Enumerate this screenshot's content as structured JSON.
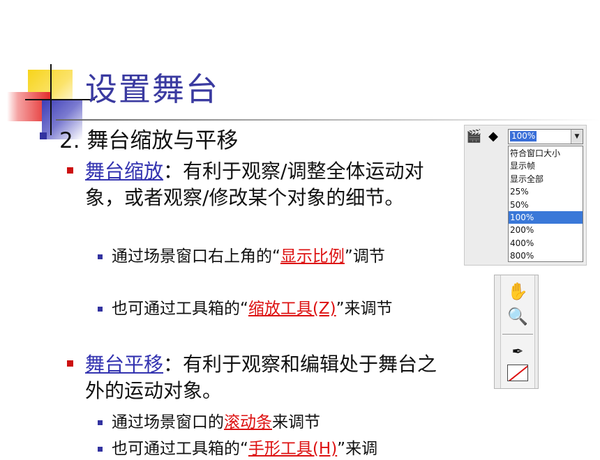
{
  "slide": {
    "title": "设置舞台",
    "heading": "2. 舞台缩放与平移",
    "points": [
      {
        "term": "舞台缩放",
        "sep": "：",
        "text": "有利于观察/调整全体运动对象，或者观察/修改某个对象的细节。",
        "subs": [
          {
            "pre": "通过场景窗口右上角的“",
            "link": "显示比例",
            "post": "”调节"
          },
          {
            "pre": "也可通过工具箱的“",
            "link": "缩放工具(Z)",
            "post": "”来调节"
          }
        ]
      },
      {
        "term": "舞台平移",
        "sep": "：",
        "text": "有利于观察和编辑处于舞台之外的运动对象。",
        "subs": [
          {
            "pre": "通过场景窗口的",
            "link": "滚动条",
            "post": "来调节"
          },
          {
            "pre": "也可通过工具箱的“",
            "link": "手形工具(H)",
            "post": "”来调"
          }
        ]
      }
    ]
  },
  "zoom_panel": {
    "current": "100%",
    "options": [
      "符合窗口大小",
      "显示帧",
      "显示全部",
      "25%",
      "50%",
      "100%",
      "200%",
      "400%",
      "800%"
    ],
    "selected_index": 5
  },
  "tools": [
    "hand-tool-icon",
    "zoom-tool-icon",
    "pen-tool-icon",
    "no-color-swatch-icon"
  ],
  "colors": {
    "title": "#3a3aa0",
    "term_link": "#3333b0",
    "sub_link": "#dd1111",
    "bullet_red": "#cc1010",
    "bullet_blue": "#3333a0"
  }
}
